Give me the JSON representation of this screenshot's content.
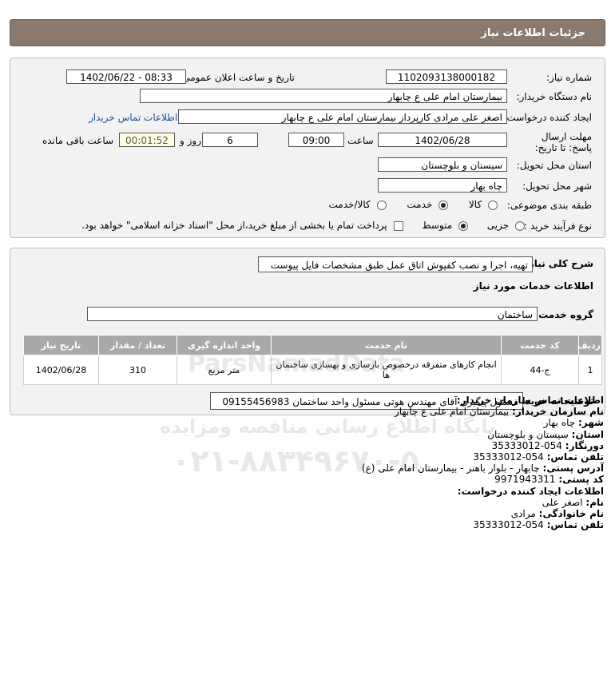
{
  "header": {
    "title": "جزئیات اطلاعات نیاز"
  },
  "details": {
    "need_number_label": "شماره نیاز:",
    "need_number": "1102093138000182",
    "announce_label": "تاریخ و ساعت اعلان عمومی:",
    "announce_value": "1402/06/22 - 08:33",
    "buyer_org_label": "نام دستگاه خریدار:",
    "buyer_org": "بیمارستان امام علی  ع  چابهار",
    "creator_label": "ایجاد کننده درخواست:",
    "creator": "اصغر علی مرادی کارپرداز بیمارستان امام علی  ع  چابهار",
    "contact_link": "اطلاعات تماس خریدار",
    "deadline_label": "مهلت ارسال پاسخ: تا تاریخ:",
    "deadline_date": "1402/06/28",
    "time_label": "ساعت",
    "deadline_time": "09:00",
    "days_value": "6",
    "days_label": "روز و",
    "remaining_time": "00:01:52",
    "remaining_label": "ساعت باقی مانده",
    "province_label": "استان محل تحویل:",
    "province": "سیستان و بلوچستان",
    "city_label": "شهر محل تحویل:",
    "city": "چاه بهار",
    "category_label": "طبقه بندی موضوعی:",
    "category_options": [
      "کالا",
      "خدمت",
      "کالا/خدمت"
    ],
    "process_label": "نوع فرآیند خرید :",
    "process_options": [
      "جزیی",
      "متوسط"
    ],
    "payment_note": "پرداخت تمام یا بخشی از مبلغ خرید،از محل \"اسناد خزانه اسلامی\" خواهد بود."
  },
  "description": {
    "label": "شرح کلی نیاز:",
    "value": "تهیه، اجرا و نصب کفپوش اتاق عمل طبق مشخصات فایل پیوست",
    "services_heading": "اطلاعات خدمات مورد نیاز",
    "group_label": "گروه خدمت:",
    "group_value": "ساختمان",
    "table": {
      "headers": [
        "ردیف",
        "کد خدمت",
        "نام خدمت",
        "واحد اندازه گیری",
        "تعداد / مقدار",
        "تاریخ نیاز"
      ],
      "rows": [
        [
          "1",
          "ج-44",
          "انجام کارهای متفرقه درخصوص بازسازی و بهسازی ساختمان ها",
          "متر مربع",
          "310",
          "1402/06/28"
        ]
      ]
    },
    "buyer_notes_label": "توضیحات خریدار:",
    "buyer_notes": "مسئول پیگیری آقای مهندس هوتی مسئول واحد ساختمان 09155456983"
  },
  "contact": {
    "title": "اطلاعات تماس سازمان خریدار:",
    "rows": [
      {
        "label": "نام سازمان خریدار:",
        "value": "بیمارستان امام علی ع چابهار"
      },
      {
        "label": "شهر:",
        "value": "چاه بهار"
      },
      {
        "label": "استان:",
        "value": "سیستان و بلوچستان"
      },
      {
        "label": "دورنگار:",
        "value": "054-35333012"
      },
      {
        "label": "تلفن تماس:",
        "value": "054-35333012"
      },
      {
        "label": "آدرس پستی:",
        "value": "چابهار - بلوار باهنر - بیمارستان امام علی (ع)"
      },
      {
        "label": "کد پستی:",
        "value": "9971943311"
      }
    ],
    "creator_title": "اطلاعات ایجاد کننده درخواست:",
    "creator_rows": [
      {
        "label": "نام:",
        "value": "اصغر علی"
      },
      {
        "label": "نام خانوادگی:",
        "value": "مرادی"
      },
      {
        "label": "تلفن تماس:",
        "value": "054-35333012"
      }
    ]
  },
  "watermark": {
    "line1": "پایگاه اطلاع رسانی مناقصه ومزایده",
    "line2": "۰۲۱-۸۸۳۴۹۶۷۰-۵",
    "brand": "ParsNamadData"
  }
}
